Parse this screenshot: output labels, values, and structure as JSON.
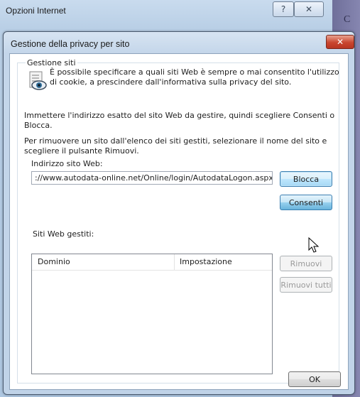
{
  "background_window": {
    "title": "Opzioni Internet",
    "help_glyph": "?",
    "close_glyph": "✕",
    "edge_text": "C"
  },
  "dialog": {
    "title": "Gestione della privacy per sito",
    "close_glyph": "✕",
    "group_label": "Gestione siti",
    "info_text": "È possibile specificare a quali siti Web è sempre o mai consentito l'utilizzo di cookie, a prescindere dall'informativa sulla privacy del sito.",
    "instructions_1": "Immettere l'indirizzo esatto del sito Web da gestire, quindi scegliere Consenti o Blocca.",
    "instructions_2": "Per rimuovere un sito dall'elenco dei siti gestiti, selezionare il nome del sito e scegliere il pulsante Rimuovi.",
    "url_label": "Indirizzo sito Web:",
    "url_value": "://www.autodata-online.net/Online/login/AutodataLogon.aspx",
    "buttons": {
      "blocca": "Blocca",
      "consenti": "Consenti",
      "rimuovi": "Rimuovi",
      "rimuovi_tutti": "Rimuovi tutti",
      "ok": "OK"
    },
    "managed_label": "Siti Web gestiti:",
    "list_columns": [
      "Dominio",
      "Impostazione"
    ],
    "list_rows": []
  },
  "colors": {
    "close_red": "#c9462f",
    "accent_blue": "#3c7fb1"
  }
}
